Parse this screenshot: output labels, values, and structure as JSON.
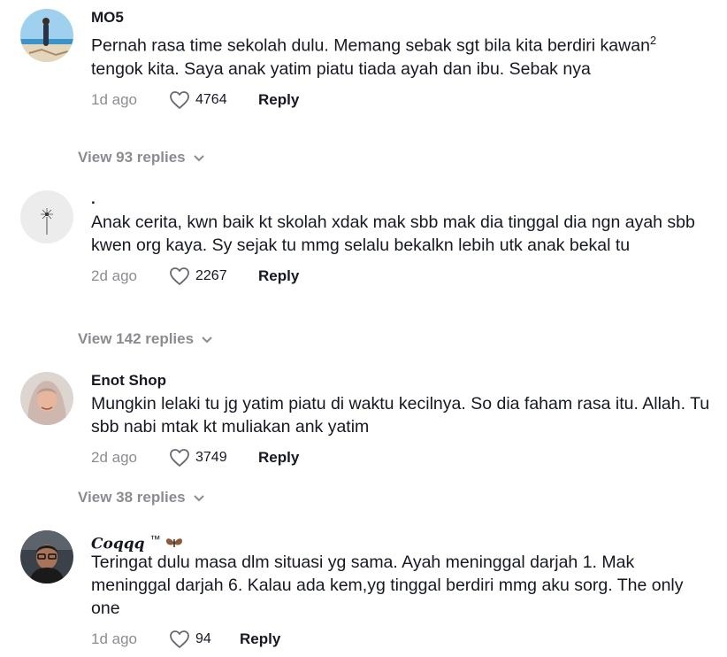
{
  "comments": [
    {
      "username": "MO5",
      "text_a": "Pernah rasa time sekolah dulu. Memang sebak sgt bila kita berdiri kawan",
      "text_sup": "2",
      "text_b": " tengok kita. Saya anak yatim piatu tiada ayah dan ibu. Sebak nya",
      "date": "1d ago",
      "likes": "4764",
      "reply_label": "Reply",
      "view_replies": "View 93 replies"
    },
    {
      "username": ".",
      "text": "Anak cerita, kwn baik kt skolah xdak mak sbb mak dia tinggal dia ngn ayah sbb kwen org kaya. Sy sejak tu mmg selalu bekalkn lebih utk anak bekal tu",
      "date": "2d ago",
      "likes": "2267",
      "reply_label": "Reply",
      "view_replies": "View 142 replies"
    },
    {
      "username": "Enot Shop",
      "text": "Mungkin lelaki tu jg yatim piatu di waktu kecilnya. So dia faham rasa itu. Allah. Tu sbb nabi mtak kt muliakan ank yatim",
      "date": "2d ago",
      "likes": "3749",
      "reply_label": "Reply",
      "view_replies": "View 38 replies"
    },
    {
      "username": "Coqqq",
      "username_tm": "™",
      "text": "Teringat dulu masa dlm situasi yg sama. Ayah meninggal darjah 1. Mak meninggal darjah 6. Kalau ada kem,yg tinggal berdiri mmg aku sorg. The only one",
      "date": "1d ago",
      "likes": "94",
      "reply_label": "Reply"
    }
  ],
  "icons": {
    "like": "heart-outline-icon",
    "expand": "chevron-down-icon",
    "moth": "moth-emoji-icon"
  },
  "colors": {
    "text_primary": "#161823",
    "text_secondary": "rgba(22,24,35,0.5)",
    "background": "#ffffff"
  }
}
